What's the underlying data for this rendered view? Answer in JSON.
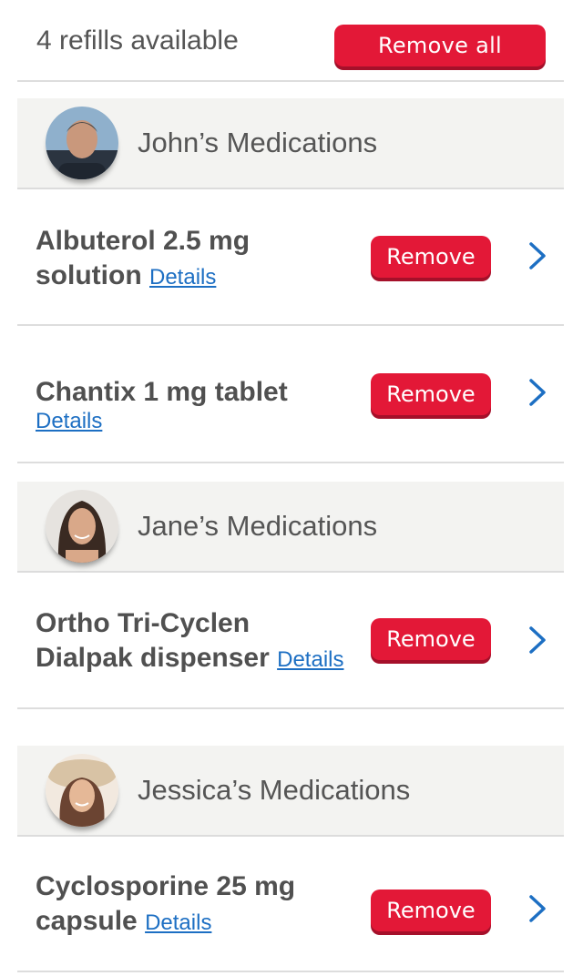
{
  "header": {
    "refills_text": "4 refills available",
    "remove_all_label": "Remove all"
  },
  "groups": [
    {
      "title": "John’s Medications",
      "items": [
        {
          "name_line1": "Albuterol 2.5 mg",
          "name_line2": "solution",
          "details_label": "Details",
          "remove_label": "Remove"
        },
        {
          "name_line1": "Chantix 1 mg tablet",
          "details_label": "Details",
          "remove_label": "Remove"
        }
      ]
    },
    {
      "title": "Jane’s Medications",
      "items": [
        {
          "name_line1": "Ortho Tri-Cyclen",
          "name_line2": "Dialpak dispenser",
          "details_label": "Details",
          "remove_label": "Remove"
        }
      ]
    },
    {
      "title": "Jessica’s Medications",
      "items": [
        {
          "name_line1": "Cyclosporine 25 mg",
          "name_line2": "capsule",
          "details_label": "Details",
          "remove_label": "Remove"
        }
      ]
    }
  ],
  "colors": {
    "accent_red": "#e31837",
    "link_blue": "#1d6fc3",
    "chevron_blue": "#1d6fc3",
    "header_bg": "#f3f3f1"
  },
  "icons": {
    "chevron": "chevron-right-icon",
    "avatar": "user-avatar"
  }
}
